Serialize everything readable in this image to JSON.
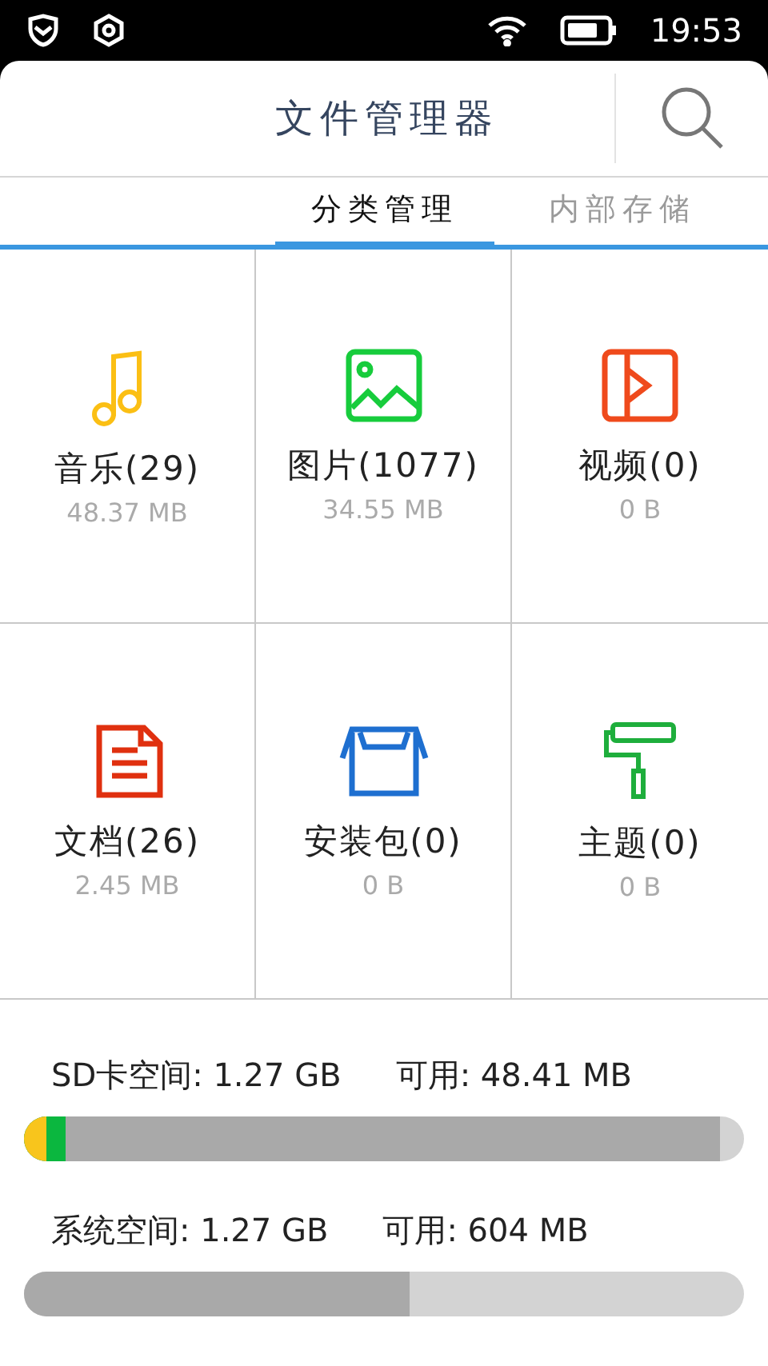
{
  "status_bar": {
    "time": "19:53"
  },
  "header": {
    "title": "文件管理器"
  },
  "tabs": [
    {
      "label": "分类管理",
      "selected": true
    },
    {
      "label": "内部存储",
      "selected": false
    }
  ],
  "categories": [
    {
      "kind": "music",
      "label": "音乐(29)",
      "size": "48.37 MB"
    },
    {
      "kind": "image",
      "label": "图片(1077)",
      "size": "34.55 MB"
    },
    {
      "kind": "video",
      "label": "视频(0)",
      "size": "0 B"
    },
    {
      "kind": "document",
      "label": "文档(26)",
      "size": "2.45 MB"
    },
    {
      "kind": "package",
      "label": "安装包(0)",
      "size": "0 B"
    },
    {
      "kind": "theme",
      "label": "主题(0)",
      "size": "0 B"
    }
  ],
  "storage": [
    {
      "total": "SD卡空间: 1.27 GB",
      "available": "可用: 48.41 MB",
      "segments": [
        {
          "color": "#a9a9a9",
          "level": 0.967
        },
        {
          "color": "#0bb73f",
          "level": 0.057
        },
        {
          "color": "#f8c51c",
          "level": 0.03
        }
      ]
    },
    {
      "total": "系统空间: 1.27 GB",
      "available": "可用: 604 MB",
      "segments": [
        {
          "color": "#a9a9a9",
          "level": 0.535
        }
      ]
    }
  ]
}
